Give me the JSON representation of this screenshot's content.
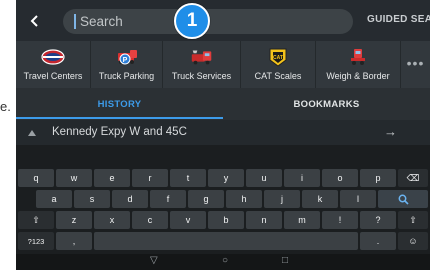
{
  "margin_text": "e.",
  "topbar": {
    "back_icon": "chevron-left-icon",
    "search_placeholder": "Search",
    "guided_search_label": "GUIDED SEARCH",
    "step_badge": "1"
  },
  "categories": [
    {
      "label": "Travel Centers",
      "icon": "travel-centers-logo"
    },
    {
      "label": "Truck Parking",
      "icon": "truck-parking-icon"
    },
    {
      "label": "Truck Services",
      "icon": "truck-services-icon"
    },
    {
      "label": "CAT Scales",
      "icon": "cat-scales-icon"
    },
    {
      "label": "Weigh & Border",
      "icon": "weigh-border-icon"
    }
  ],
  "more_label": "•••",
  "tabs": {
    "history": "HISTORY",
    "bookmarks": "BOOKMARKS",
    "active": "history"
  },
  "result": {
    "text": "Kennedy Expy W and 45C",
    "arrow": "→"
  },
  "keyboard": {
    "row1": [
      "q",
      "w",
      "e",
      "r",
      "t",
      "y",
      "u",
      "i",
      "o",
      "p"
    ],
    "row2": [
      "a",
      "s",
      "d",
      "f",
      "g",
      "h",
      "j",
      "k",
      "l"
    ],
    "row3": [
      "z",
      "x",
      "c",
      "v",
      "b",
      "n",
      "m",
      "!",
      "?"
    ],
    "sym_label": "?123",
    "comma": ",",
    "period": ".",
    "shift_symbol": "⇧",
    "backspace_symbol": "⌫",
    "search_symbol": "⚲",
    "emoji_symbol": "☺"
  },
  "nav": {
    "back": "▽",
    "home": "○",
    "recents": "□"
  },
  "colors": {
    "accent": "#3d9be9",
    "badge": "#1f8ee8"
  }
}
